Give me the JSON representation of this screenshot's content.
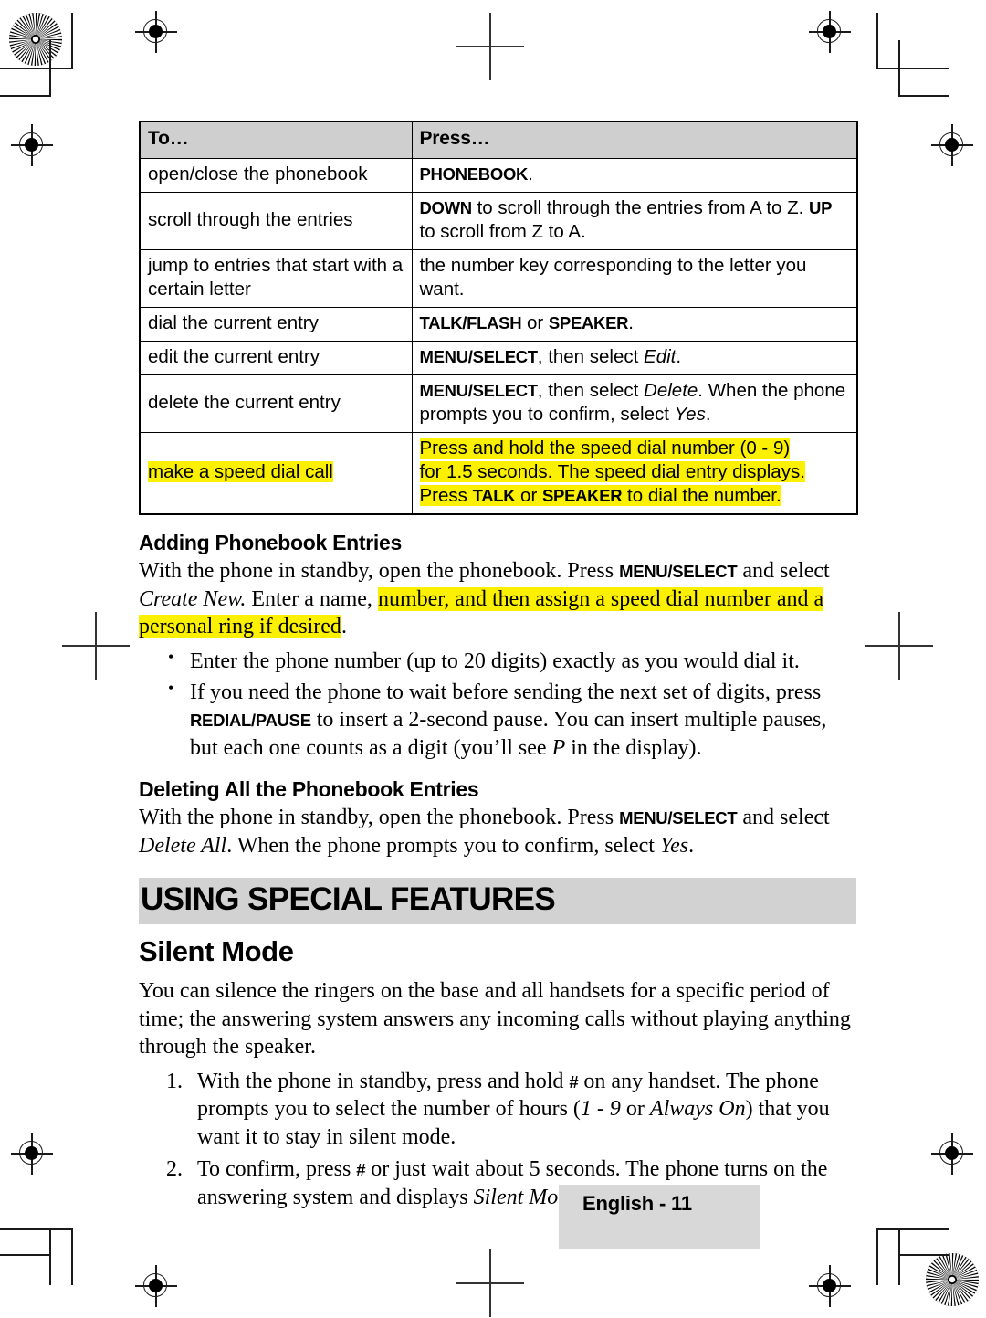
{
  "page": {
    "footer_label": "English - 11",
    "highlight_color": "#FAF000",
    "chapter_bar_color": "#D2D2D2",
    "table_header_color": "#CFCFCF"
  },
  "table": {
    "headers": [
      "To…",
      "Press…"
    ],
    "rows": [
      {
        "to": "open/close the phonebook",
        "press_segments": [
          {
            "text": "PHONEBOOK",
            "style": "key"
          },
          {
            "text": ".",
            "style": "plain"
          }
        ]
      },
      {
        "to": "scroll through the entries",
        "press_segments": [
          {
            "text": "DOWN",
            "style": "key"
          },
          {
            "text": " to scroll through the entries from A to Z. ",
            "style": "plain"
          },
          {
            "text": "UP",
            "style": "key"
          },
          {
            "text": " to scroll from Z to A.",
            "style": "plain"
          }
        ]
      },
      {
        "to": "jump to entries that start with a certain letter",
        "press_segments": [
          {
            "text": "the number key corresponding to the letter you want.",
            "style": "plain"
          }
        ]
      },
      {
        "to": "dial the current entry",
        "press_segments": [
          {
            "text": "TALK/FLASH",
            "style": "key"
          },
          {
            "text": " or ",
            "style": "plain"
          },
          {
            "text": "SPEAKER",
            "style": "key"
          },
          {
            "text": ".",
            "style": "plain"
          }
        ]
      },
      {
        "to": "edit the current entry",
        "press_segments": [
          {
            "text": "MENU/SELECT",
            "style": "key"
          },
          {
            "text": ", then select ",
            "style": "plain"
          },
          {
            "text": "Edit",
            "style": "italic"
          },
          {
            "text": ".",
            "style": "plain"
          }
        ]
      },
      {
        "to": "delete the current entry",
        "press_segments": [
          {
            "text": "MENU/SELECT",
            "style": "key"
          },
          {
            "text": ", then select ",
            "style": "plain"
          },
          {
            "text": "Delete",
            "style": "italic"
          },
          {
            "text": ". When the phone prompts you to confirm, select ",
            "style": "plain"
          },
          {
            "text": "Yes",
            "style": "italic"
          },
          {
            "text": ".",
            "style": "plain"
          }
        ]
      },
      {
        "to": "make a speed dial call",
        "to_highlighted": true,
        "press_highlighted": true,
        "press_lines": [
          [
            {
              "text": "Press and hold the speed dial number (0 - 9)",
              "style": "plain"
            }
          ],
          [
            {
              "text": "for 1.5 seconds. The speed dial entry displays.",
              "style": "plain"
            }
          ],
          [
            {
              "text": "Press ",
              "style": "plain"
            },
            {
              "text": "TALK",
              "style": "key"
            },
            {
              "text": " or ",
              "style": "plain"
            },
            {
              "text": "SPEAKER",
              "style": "key"
            },
            {
              "text": " to dial the number.",
              "style": "plain"
            }
          ]
        ]
      }
    ]
  },
  "adding": {
    "heading": "Adding Phonebook Entries",
    "paragraph_segments": [
      {
        "text": "With the phone in standby, open the phonebook. Press ",
        "style": "plain"
      },
      {
        "text": "MENU/SELECT",
        "style": "key"
      },
      {
        "text": " and select ",
        "style": "plain"
      },
      {
        "text": "Create New.",
        "style": "italic"
      },
      {
        "text": " Enter a name, ",
        "style": "plain"
      },
      {
        "text": "number, and then assign a speed dial number and a personal ring if desired",
        "style": "highlight"
      },
      {
        "text": ".",
        "style": "plain"
      }
    ],
    "bullets": [
      [
        {
          "text": "Enter the phone number (up to 20 digits) exactly as you would dial it.",
          "style": "plain"
        }
      ],
      [
        {
          "text": "If you need the phone to wait before sending the next set of digits, press ",
          "style": "plain"
        },
        {
          "text": "REDIAL/PAUSE",
          "style": "key"
        },
        {
          "text": " to insert a 2-second pause. You can insert multiple pauses, but each one counts as a digit (you’ll see ",
          "style": "plain"
        },
        {
          "text": "P",
          "style": "italic"
        },
        {
          "text": " in the display).",
          "style": "plain"
        }
      ]
    ]
  },
  "deleting": {
    "heading": "Deleting All the Phonebook Entries",
    "paragraph_segments": [
      {
        "text": "With the phone in standby, open the phonebook. Press ",
        "style": "plain"
      },
      {
        "text": "MENU/SELECT",
        "style": "key"
      },
      {
        "text": " and select ",
        "style": "plain"
      },
      {
        "text": "Delete All",
        "style": "italic"
      },
      {
        "text": ". When the phone prompts you to confirm, select ",
        "style": "plain"
      },
      {
        "text": "Yes",
        "style": "italic"
      },
      {
        "text": ".",
        "style": "plain"
      }
    ]
  },
  "chapter": {
    "title": "USING SPECIAL FEATURES"
  },
  "silent_mode": {
    "heading": "Silent Mode",
    "paragraph_segments": [
      {
        "text": "You can silence the ringers on the base and all handsets for a specific period of time; the answering system answers any incoming calls without playing anything through the speaker.",
        "style": "plain"
      }
    ],
    "steps": [
      [
        {
          "text": "With the phone in standby, press and hold ",
          "style": "plain"
        },
        {
          "text": "#",
          "style": "key"
        },
        {
          "text": " on any handset. The phone prompts you to select the number of hours (",
          "style": "plain"
        },
        {
          "text": "1 - 9",
          "style": "italic"
        },
        {
          "text": " or ",
          "style": "plain"
        },
        {
          "text": "Always On",
          "style": "italic"
        },
        {
          "text": ") that you want it to stay in silent mode.",
          "style": "plain"
        }
      ],
      [
        {
          "text": "To confirm, press ",
          "style": "plain"
        },
        {
          "text": "#",
          "style": "key"
        },
        {
          "text": " or just wait about 5 seconds. The phone turns on the answering system and displays ",
          "style": "plain"
        },
        {
          "text": "Silent Mode On",
          "style": "italic"
        },
        {
          "text": " on each handset.",
          "style": "plain"
        }
      ]
    ]
  }
}
